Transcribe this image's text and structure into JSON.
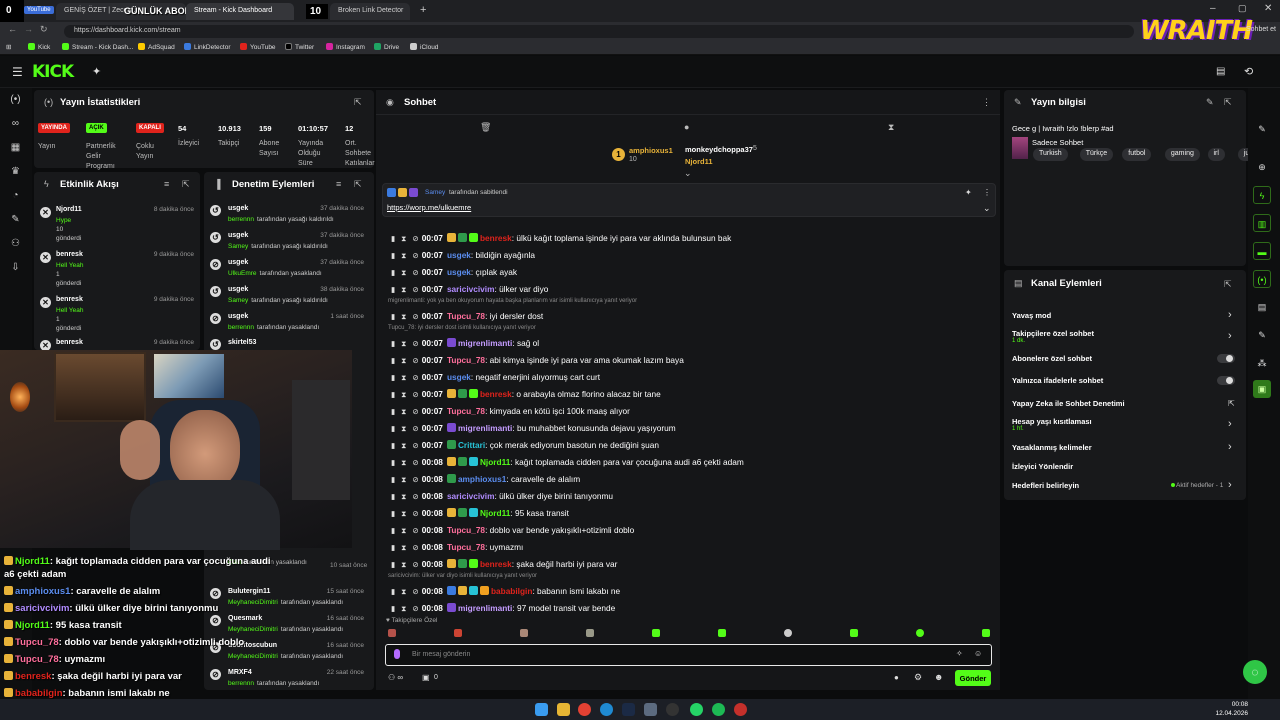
{
  "overlay_top": {
    "left_num": "0",
    "right_num": "10",
    "title": "GÜNLÜK ABONE",
    "tag": "YouTube"
  },
  "browser": {
    "tabs": [
      "GENİŞ ÖZET | Zecom...",
      "Stream - Kick Dashboard",
      "Broken Link Detector"
    ],
    "url": "https://dashboard.kick.com/stream",
    "bookmarks": [
      "Kick",
      "Stream - Kick Dash...",
      "AdSquad",
      "LinkDetector",
      "YouTube",
      "Twitter",
      "Instagram",
      "Drive",
      "iCloud"
    ]
  },
  "wraith": {
    "logo": "WRAITH",
    "chat_label": "Sohbet et"
  },
  "kick": {
    "logo": "KICK"
  },
  "stats": {
    "title": "Yayın İstatistikleri",
    "items": [
      {
        "badge": "YAYINDA",
        "label": "Yayın",
        "color": "#e0231c"
      },
      {
        "badge": "AÇIK",
        "label": "Partnerlik Gelir Programı",
        "color": "#53fc18"
      },
      {
        "badge": "KAPALI",
        "label": "Çoklu Yayın",
        "color": "#e0231c"
      },
      {
        "value": "54",
        "label": "İzleyici"
      },
      {
        "value": "10.913",
        "label": "Takipçi"
      },
      {
        "value": "159",
        "label": "Abone Sayısı"
      },
      {
        "value": "01:10:57",
        "label": "Yayında Olduğu Süre"
      },
      {
        "value": "12",
        "label": "Ort. Sohbete Katılanlar"
      }
    ]
  },
  "activity": {
    "title": "Etkinlik Akışı",
    "items": [
      {
        "name": "Njord11",
        "time": "8 dakika önce",
        "line1": "Hype",
        "line2": "10",
        "line3": "gönderdi"
      },
      {
        "name": "benresk",
        "time": "9 dakika önce",
        "line1": "Hell Yeah",
        "line2": "1",
        "line3": "gönderdi"
      },
      {
        "name": "benresk",
        "time": "9 dakika önce",
        "line1": "Hell Yeah",
        "line2": "1",
        "line3": "gönderdi"
      },
      {
        "name": "benresk",
        "time": "9 dakika önce",
        "line1": "",
        "line2": "",
        "line3": ""
      }
    ]
  },
  "moderation": {
    "title": "Denetim Eylemleri",
    "items": [
      {
        "name": "usgek",
        "time": "37 dakika önce",
        "actor": "berrennn",
        "action": "tarafından yasağı kaldırıldı",
        "icon": "↺"
      },
      {
        "name": "usgek",
        "time": "37 dakika önce",
        "actor": "Samey",
        "action": "tarafından yasağı kaldırıldı",
        "icon": "↺"
      },
      {
        "name": "usgek",
        "time": "37 dakika önce",
        "actor": "UlkuEmre",
        "action": "tarafından yasaklandı",
        "icon": "⊘"
      },
      {
        "name": "usgek",
        "time": "38 dakika önce",
        "actor": "Samey",
        "action": "tarafından yasağı kaldırıldı",
        "icon": "↺"
      },
      {
        "name": "usgek",
        "time": "1 saat önce",
        "actor": "berrennn",
        "action": "tarafından yasaklandı",
        "icon": "⊘"
      },
      {
        "name": "skirtel53",
        "time": "",
        "actor": "",
        "action": "",
        "icon": "↺"
      }
    ],
    "lower": [
      {
        "name": "Bulutergin11",
        "time": "15 saat önce",
        "actor": "MeyhaneciDimitri",
        "action": "tarafından yasaklandı",
        "icon": "⊘"
      },
      {
        "name": "Quesmark",
        "time": "16 saat önce",
        "actor": "MeyhaneciDimitri",
        "action": "tarafından yasaklandı",
        "icon": "⊘"
      },
      {
        "name": "dooritoscubun",
        "time": "16 saat önce",
        "actor": "MeyhaneciDimitri",
        "action": "tarafından yasaklandı",
        "icon": "⊘"
      },
      {
        "name": "MRXF4",
        "time": "22 saat önce",
        "actor": "berrennn",
        "action": "tarafından yasaklandı",
        "icon": "⊘"
      }
    ],
    "partial": [
      {
        "name": "Cevs",
        "time": "10 saat önce",
        "action": "tarafından yasaklandı"
      }
    ]
  },
  "chat": {
    "title": "Sohbet",
    "top": {
      "name1": "amphioxus1",
      "val1": "10",
      "name2": "monkeydchoppa37",
      "val2": "5",
      "name3": "Njord11"
    },
    "pinned": {
      "by": "Samey",
      "text": "tarafından sabitlendi",
      "link": "https://worp.me/ulkuemre"
    },
    "messages": [
      {
        "time": "00:07",
        "user": "benresk",
        "color": "#e0231c",
        "text": ": ülkü kağıt toplama işinde iyi para var aklında bulunsun bak",
        "badges": [
          "#e8b339",
          "#2f9a4b",
          "#53fc18"
        ]
      },
      {
        "time": "00:07",
        "user": "usgek",
        "color": "#5b8def",
        "text": ": bildiğin ayağınla",
        "badges": []
      },
      {
        "time": "00:07",
        "user": "usgek",
        "color": "#5b8def",
        "text": ": çıplak ayak",
        "badges": []
      },
      {
        "time": "00:07",
        "user": "saricivcivim",
        "color": "#b18cff",
        "text": ": ülker var diyo",
        "badges": []
      },
      {
        "reply": "migrenlimanti: yok ya ben okuyorum hayata başka planlarım var isimli kullanıcıya yanıt veriyor"
      },
      {
        "time": "00:07",
        "user": "Tupcu_78",
        "color": "#ff6f9c",
        "text": ": iyi dersler dost",
        "badges": []
      },
      {
        "reply": "Tupcu_78: iyi dersler dost isimli kullanıcıya yanıt veriyor"
      },
      {
        "time": "00:07",
        "user": "migrenlimanti",
        "color": "#c49cff",
        "text": ": sağ ol",
        "badges": [
          "#7a4bd1"
        ]
      },
      {
        "time": "00:07",
        "user": "Tupcu_78",
        "color": "#ff6f9c",
        "text": ": abi kimya işinde iyi para var ama okumak lazım baya",
        "badges": []
      },
      {
        "time": "00:07",
        "user": "usgek",
        "color": "#5b8def",
        "text": ": negatif enerjini alıyormuş cart curt",
        "badges": []
      },
      {
        "time": "00:07",
        "user": "benresk",
        "color": "#e0231c",
        "text": ": o arabayla olmaz florino alacaz bir tane",
        "badges": [
          "#e8b339",
          "#2f9a4b",
          "#53fc18"
        ]
      },
      {
        "time": "00:07",
        "user": "Tupcu_78",
        "color": "#ff6f9c",
        "text": ": kimyada en kötü işci 100k maaş alıyor",
        "badges": []
      },
      {
        "time": "00:07",
        "user": "migrenlimanti",
        "color": "#c49cff",
        "text": ": bu muhabbet konusunda dejavu yaşıyorum",
        "badges": [
          "#7a4bd1"
        ]
      },
      {
        "time": "00:07",
        "user": "Crittari",
        "color": "#27c2d6",
        "text": ": çok merak ediyorum basotun ne dediğini şuan",
        "badges": [
          "#2f9a4b"
        ]
      },
      {
        "time": "00:08",
        "user": "Njord11",
        "color": "#53fc18",
        "text": ": kağıt toplamada cidden para var çocuğuna audi a6 çekti adam",
        "badges": [
          "#e8b339",
          "#2f9a4b",
          "#27c2d6"
        ]
      },
      {
        "time": "00:08",
        "user": "amphioxus1",
        "color": "#5b8def",
        "text": ": caravelle de alalım",
        "badges": [
          "#2f9a4b"
        ]
      },
      {
        "time": "00:08",
        "user": "saricivcivim",
        "color": "#b18cff",
        "text": ": ülkü ülker diye birini tanıyonmu",
        "badges": []
      },
      {
        "time": "00:08",
        "user": "Njord11",
        "color": "#53fc18",
        "text": ": 95 kasa transit",
        "badges": [
          "#e8b339",
          "#2f9a4b",
          "#27c2d6"
        ]
      },
      {
        "time": "00:08",
        "user": "Tupcu_78",
        "color": "#ff6f9c",
        "text": ": doblo var bende yakışıklı+otizimli doblo",
        "badges": []
      },
      {
        "time": "00:08",
        "user": "Tupcu_78",
        "color": "#ff6f9c",
        "text": ": uymazmı",
        "badges": []
      },
      {
        "time": "00:08",
        "user": "benresk",
        "color": "#e0231c",
        "text": ": şaka değil harbi iyi para var",
        "badges": [
          "#e8b339",
          "#2f9a4b",
          "#53fc18"
        ]
      },
      {
        "reply": "saricivcivim: ülker var diyo isimli kullanıcıya yanıt veriyor"
      },
      {
        "time": "00:08",
        "user": "bababilgin",
        "color": "#e0231c",
        "text": ": babanın ismi lakabı ne",
        "badges": [
          "#3b7be0",
          "#e8b339",
          "#27c2d6",
          "#f0a020"
        ]
      },
      {
        "time": "00:08",
        "user": "migrenlimanti",
        "color": "#c49cff",
        "text": ": 97 model transit var bende",
        "badges": [
          "#7a4bd1"
        ]
      }
    ],
    "input_placeholder": "Bir mesaj gönderin",
    "followers_label": "Takipçilere Özel",
    "send_label": "Gönder",
    "count_left": "0"
  },
  "stream_info": {
    "title": "Yayın bilgisi",
    "stream_title": "Gece g | Iwraith !zlo !blerp #ad",
    "category": "Sadece Sohbet",
    "tags": [
      "Turkish",
      "Türkçe",
      "futbol",
      "gaming",
      "irl",
      "justchatting"
    ]
  },
  "channel_actions": {
    "title": "Kanal Eylemleri",
    "rows": [
      {
        "label": "Yavaş mod",
        "control": "chevron"
      },
      {
        "label": "Takipçilere özel sohbet",
        "sub": "1 dk.",
        "control": "chevron"
      },
      {
        "label": "Abonelere özel sohbet",
        "control": "toggle"
      },
      {
        "label": "Yalnızca ifadelerle sohbet",
        "control": "toggle"
      },
      {
        "label": "Yapay Zeka ile Sohbet Denetimi",
        "control": "external"
      },
      {
        "label": "Hesap yaşı kısıtlaması",
        "sub": "1 hf.",
        "control": "chevron"
      },
      {
        "label": "Yasaklanmış kelimeler",
        "control": "chevron"
      },
      {
        "label": "İzleyici Yönlendir",
        "control": "none"
      },
      {
        "label": "Hedefleri belirleyin",
        "extra": "Aktif hedefler - 1",
        "control": "chevron"
      }
    ]
  },
  "overlay_chat": [
    {
      "user": "Njord11",
      "text": ": kağıt toplamada cidden para var çocuğuna audi",
      "color": "#53fc18"
    },
    {
      "user": "",
      "text": "a6 çekti adam",
      "color": "#fff"
    },
    {
      "user": "amphioxus1",
      "text": ": caravelle de alalım",
      "color": "#5b8def"
    },
    {
      "user": "saricivcivim",
      "text": ": ülkü ülker diye birini tanıyonmu",
      "color": "#b18cff"
    },
    {
      "user": "Njord11",
      "text": ": 95 kasa transit",
      "color": "#53fc18"
    },
    {
      "user": "Tupcu_78",
      "text": ": doblo var bende yakışıklı+otizimli doblo",
      "color": "#ff6f9c"
    },
    {
      "user": "Tupcu_78",
      "text": ": uymazmı",
      "color": "#ff6f9c"
    },
    {
      "user": "benresk",
      "text": ": şaka değil harbi iyi para var",
      "color": "#e0231c"
    },
    {
      "user": "bababilgin",
      "text": ": babanın ismi lakabı ne",
      "color": "#e0231c"
    },
    {
      "user": "migrenlimanti",
      "text": ": 97 model transit var bende",
      "color": "#c49cff"
    }
  ],
  "taskbar": {
    "time": "00:08",
    "date": "12.04.2026"
  }
}
